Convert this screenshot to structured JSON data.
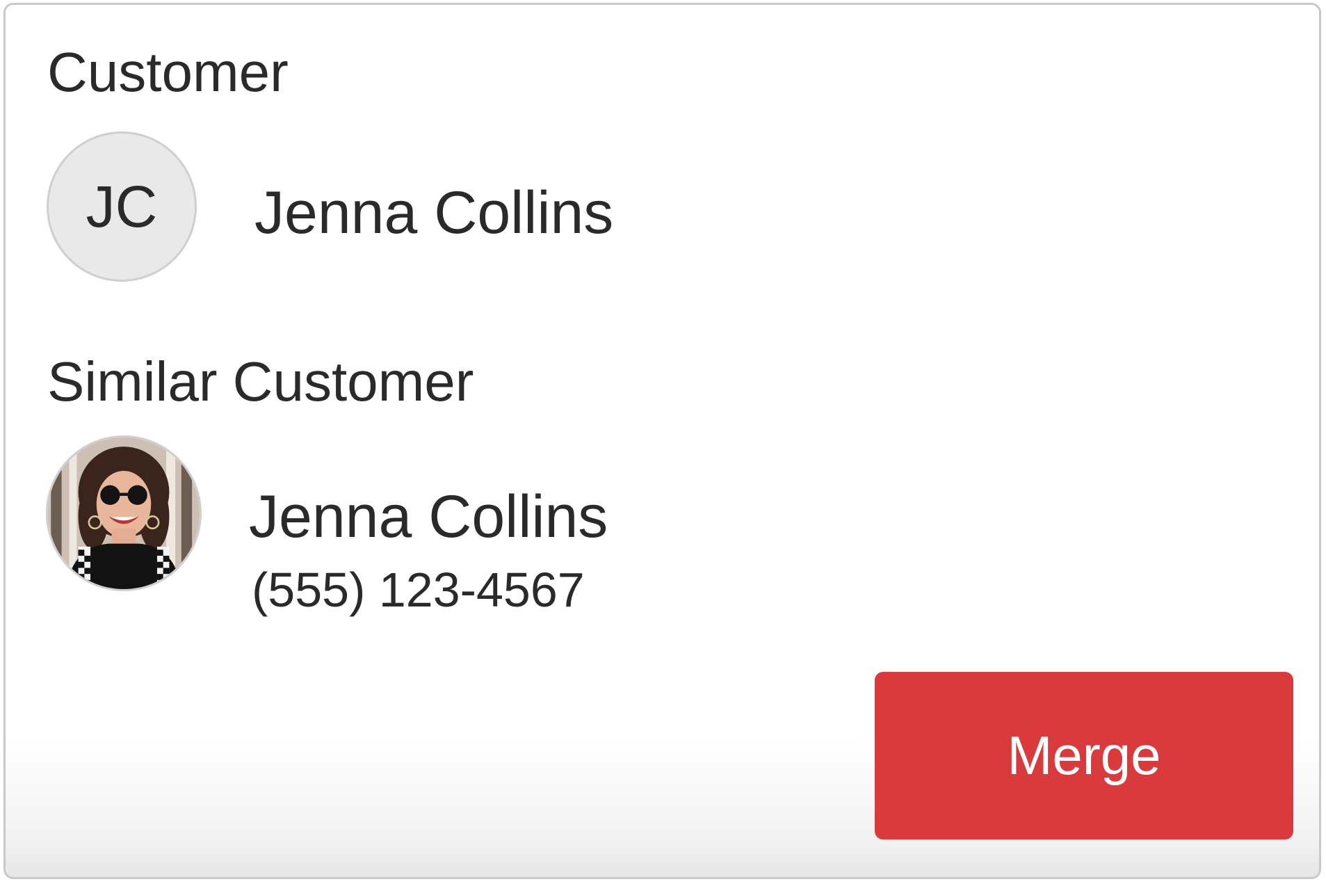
{
  "customer": {
    "section_title": "Customer",
    "initials": "JC",
    "name": "Jenna Collins"
  },
  "similar_customer": {
    "section_title": "Similar Customer",
    "avatar": "customer-photo",
    "name": "Jenna Collins",
    "phone": "(555) 123-4567"
  },
  "actions": {
    "merge_label": "Merge"
  },
  "colors": {
    "accent": "#d93a3c",
    "avatar_bg": "#e9e9e9",
    "text": "#2a2a2a"
  }
}
